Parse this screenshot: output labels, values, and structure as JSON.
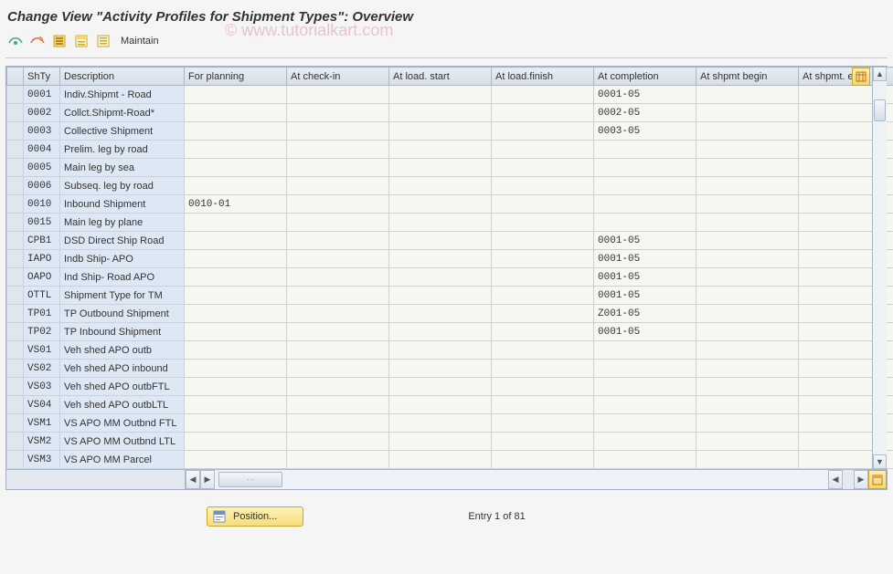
{
  "title": "Change View \"Activity Profiles for Shipment Types\": Overview",
  "watermark": "©  www.tutorialkart.com",
  "toolbar": {
    "maintain": "Maintain"
  },
  "columns": {
    "shty": "ShTy",
    "desc": "Description",
    "forplan": "For planning",
    "checkin": "At check-in",
    "loadstart": "At load. start",
    "loadfinish": "At load.finish",
    "completion": "At completion",
    "shpbegin": "At shpmt begin",
    "shpend": "At shpmt. end"
  },
  "rows": [
    {
      "shty": "0001",
      "desc": "Indiv.Shipmt - Road",
      "forplan": "",
      "checkin": "",
      "loadstart": "",
      "loadfinish": "",
      "completion": "0001-05",
      "shpbegin": "",
      "shpend": ""
    },
    {
      "shty": "0002",
      "desc": "Collct.Shipmt-Road*",
      "forplan": "",
      "checkin": "",
      "loadstart": "",
      "loadfinish": "",
      "completion": "0002-05",
      "shpbegin": "",
      "shpend": ""
    },
    {
      "shty": "0003",
      "desc": "Collective Shipment",
      "forplan": "",
      "checkin": "",
      "loadstart": "",
      "loadfinish": "",
      "completion": "0003-05",
      "shpbegin": "",
      "shpend": ""
    },
    {
      "shty": "0004",
      "desc": "Prelim. leg by road",
      "forplan": "",
      "checkin": "",
      "loadstart": "",
      "loadfinish": "",
      "completion": "",
      "shpbegin": "",
      "shpend": ""
    },
    {
      "shty": "0005",
      "desc": "Main leg by sea",
      "forplan": "",
      "checkin": "",
      "loadstart": "",
      "loadfinish": "",
      "completion": "",
      "shpbegin": "",
      "shpend": ""
    },
    {
      "shty": "0006",
      "desc": "Subseq. leg by road",
      "forplan": "",
      "checkin": "",
      "loadstart": "",
      "loadfinish": "",
      "completion": "",
      "shpbegin": "",
      "shpend": ""
    },
    {
      "shty": "0010",
      "desc": "Inbound Shipment",
      "forplan": "0010-01",
      "checkin": "",
      "loadstart": "",
      "loadfinish": "",
      "completion": "",
      "shpbegin": "",
      "shpend": ""
    },
    {
      "shty": "0015",
      "desc": "Main leg by plane",
      "forplan": "",
      "checkin": "",
      "loadstart": "",
      "loadfinish": "",
      "completion": "",
      "shpbegin": "",
      "shpend": ""
    },
    {
      "shty": "CPB1",
      "desc": "DSD Direct Ship Road",
      "forplan": "",
      "checkin": "",
      "loadstart": "",
      "loadfinish": "",
      "completion": "0001-05",
      "shpbegin": "",
      "shpend": ""
    },
    {
      "shty": "IAPO",
      "desc": "Indb Ship- APO",
      "forplan": "",
      "checkin": "",
      "loadstart": "",
      "loadfinish": "",
      "completion": "0001-05",
      "shpbegin": "",
      "shpend": ""
    },
    {
      "shty": "OAPO",
      "desc": "Ind Ship- Road APO",
      "forplan": "",
      "checkin": "",
      "loadstart": "",
      "loadfinish": "",
      "completion": "0001-05",
      "shpbegin": "",
      "shpend": ""
    },
    {
      "shty": "OTTL",
      "desc": "Shipment Type for TM",
      "forplan": "",
      "checkin": "",
      "loadstart": "",
      "loadfinish": "",
      "completion": "0001-05",
      "shpbegin": "",
      "shpend": ""
    },
    {
      "shty": "TP01",
      "desc": "TP Outbound Shipment",
      "forplan": "",
      "checkin": "",
      "loadstart": "",
      "loadfinish": "",
      "completion": "Z001-05",
      "shpbegin": "",
      "shpend": ""
    },
    {
      "shty": "TP02",
      "desc": "TP Inbound Shipment",
      "forplan": "",
      "checkin": "",
      "loadstart": "",
      "loadfinish": "",
      "completion": "0001-05",
      "shpbegin": "",
      "shpend": ""
    },
    {
      "shty": "VS01",
      "desc": "Veh shed APO outb",
      "forplan": "",
      "checkin": "",
      "loadstart": "",
      "loadfinish": "",
      "completion": "",
      "shpbegin": "",
      "shpend": ""
    },
    {
      "shty": "VS02",
      "desc": "Veh shed APO inbound",
      "forplan": "",
      "checkin": "",
      "loadstart": "",
      "loadfinish": "",
      "completion": "",
      "shpbegin": "",
      "shpend": ""
    },
    {
      "shty": "VS03",
      "desc": "Veh shed APO outbFTL",
      "forplan": "",
      "checkin": "",
      "loadstart": "",
      "loadfinish": "",
      "completion": "",
      "shpbegin": "",
      "shpend": ""
    },
    {
      "shty": "VS04",
      "desc": "Veh shed APO outbLTL",
      "forplan": "",
      "checkin": "",
      "loadstart": "",
      "loadfinish": "",
      "completion": "",
      "shpbegin": "",
      "shpend": ""
    },
    {
      "shty": "VSM1",
      "desc": "VS APO MM Outbnd FTL",
      "forplan": "",
      "checkin": "",
      "loadstart": "",
      "loadfinish": "",
      "completion": "",
      "shpbegin": "",
      "shpend": ""
    },
    {
      "shty": "VSM2",
      "desc": "VS APO MM Outbnd LTL",
      "forplan": "",
      "checkin": "",
      "loadstart": "",
      "loadfinish": "",
      "completion": "",
      "shpbegin": "",
      "shpend": ""
    },
    {
      "shty": "VSM3",
      "desc": "VS APO MM Parcel",
      "forplan": "",
      "checkin": "",
      "loadstart": "",
      "loadfinish": "",
      "completion": "",
      "shpbegin": "",
      "shpend": ""
    }
  ],
  "position_button": "Position...",
  "entry_text": "Entry 1 of 81"
}
